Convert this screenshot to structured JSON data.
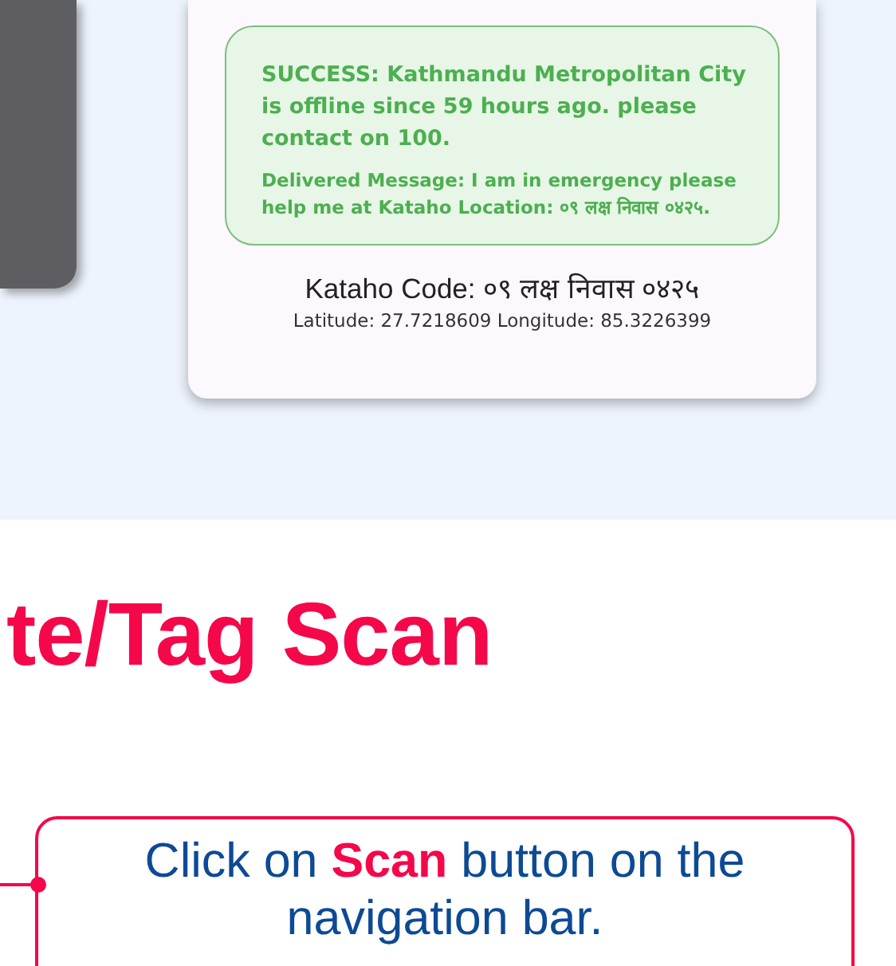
{
  "phone_screen": {
    "message": {
      "status": "SUCCESS: Kathmandu Metropolitan City is offline since 59 hours ago. please contact on 100.",
      "delivered": "Delivered Message: I am in emergency please help me at Kataho Location: ०९ लक्ष निवास ०४२५."
    },
    "kataho_code": "Kataho Code: ०९ लक्ष निवास ०४२५",
    "coordinates": "Latitude: 27.7218609 Longitude: 85.3226399"
  },
  "heading": "te/Tag Scan",
  "callout": "Click on **Scan** button on the navigation bar."
}
